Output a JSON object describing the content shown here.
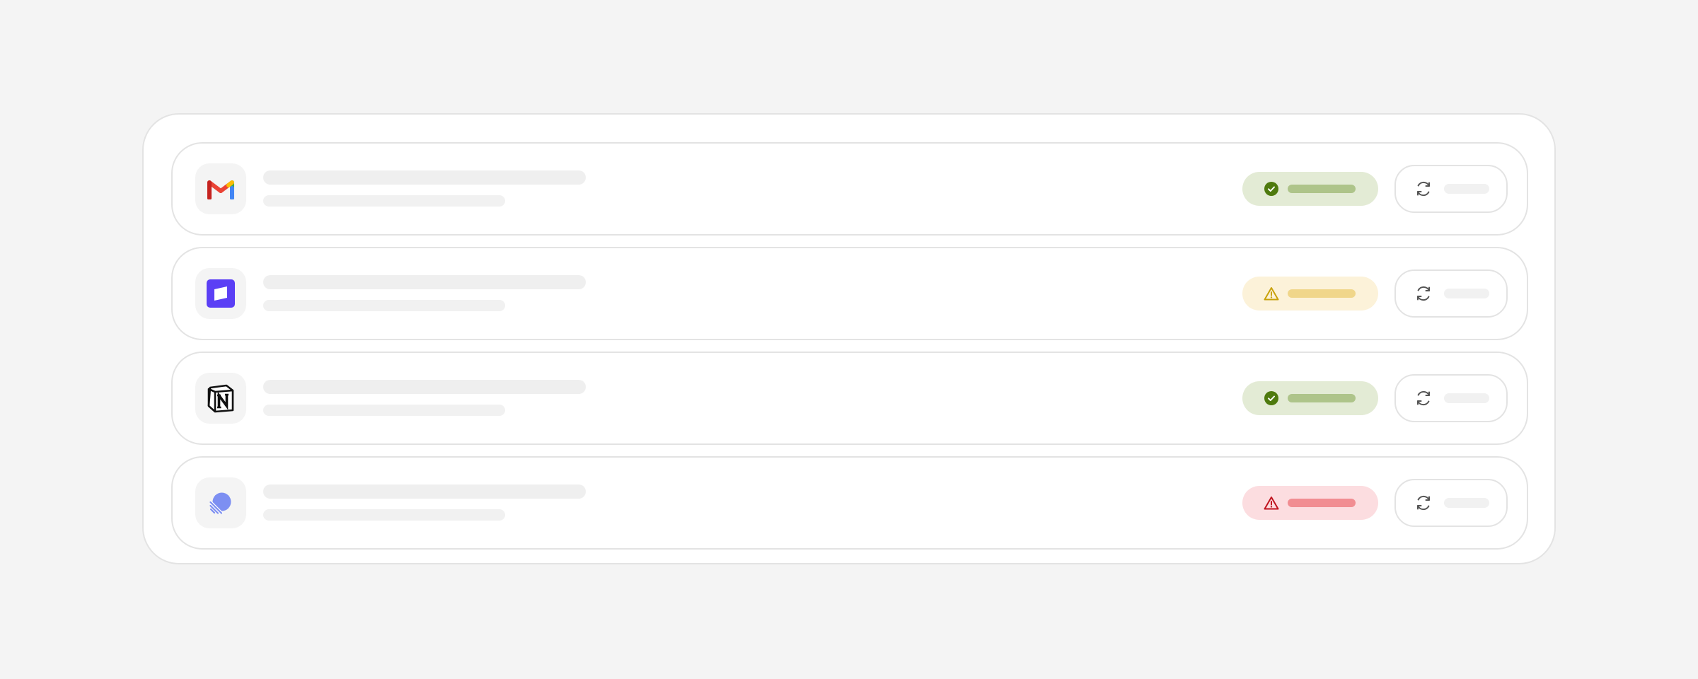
{
  "integrations": [
    {
      "app": "gmail",
      "app_icon": "gmail-icon",
      "status": "ok",
      "status_icon": "check-circle-icon",
      "status_color": "#4e7a0e",
      "action_icon": "refresh-icon"
    },
    {
      "app": "front",
      "app_icon": "front-icon",
      "status": "warning",
      "status_icon": "warning-triangle-icon",
      "status_color": "#c9a20a",
      "action_icon": "refresh-icon"
    },
    {
      "app": "notion",
      "app_icon": "notion-icon",
      "status": "ok",
      "status_icon": "check-circle-icon",
      "status_color": "#4e7a0e",
      "action_icon": "refresh-icon"
    },
    {
      "app": "linear",
      "app_icon": "linear-icon",
      "status": "error",
      "status_icon": "error-triangle-icon",
      "status_color": "#c0141f",
      "action_icon": "refresh-icon"
    }
  ],
  "colors": {
    "background": "#f4f4f4",
    "panel": "#ffffff",
    "border": "#e3e3e3",
    "skeleton": "#efefef",
    "ok_pill": "#e3ebd5",
    "warn_pill": "#fcf2d9",
    "error_pill": "#fcdde0",
    "front_brand": "#5b3ff5",
    "linear_brand": "#7d8ff2"
  }
}
